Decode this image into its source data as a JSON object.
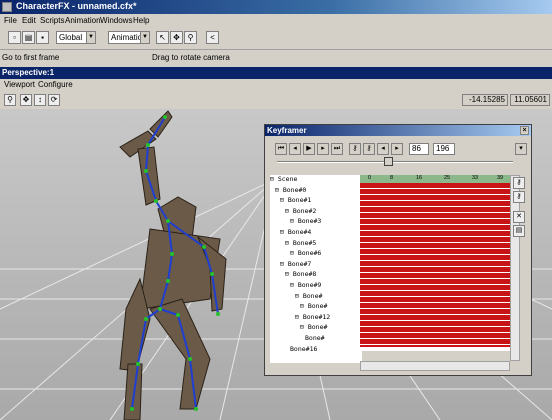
{
  "window": {
    "title": "CharacterFX - unnamed.cfx*"
  },
  "menu": [
    "File",
    "Edit",
    "Scripts",
    "Animation",
    "Windows",
    "Help"
  ],
  "toolbar": {
    "space_value": "Global",
    "mode_value": "Animation"
  },
  "status": {
    "left": "Go to first frame",
    "center": "Drag to rotate camera"
  },
  "viewport": {
    "title": "Perspective:1",
    "menu": [
      "Viewport",
      "Configure"
    ],
    "coord_x": "-14.15285",
    "coord_y": "11.05601"
  },
  "keyframer": {
    "title": "Keyframer",
    "current_frame": "86",
    "end_frame": "196",
    "slider_position": 0.47,
    "frame_ticks": [
      "0",
      "8",
      "16",
      "25",
      "33",
      "39"
    ],
    "tree": [
      "Scene",
      "Bone#0",
      "Bone#1",
      "Bone#2",
      "Bone#3",
      "Bone#4",
      "Bone#5",
      "Bone#6",
      "Bone#7",
      "Bone#8",
      "Bone#9",
      "Bone#",
      "Bone#",
      "Bone#12",
      "Bone#",
      "Bone#",
      "Bone#16"
    ]
  },
  "colors": {
    "titlebar": "#0a246a",
    "key": "#c81414",
    "keyheader": "#8ab88a",
    "bone": "#1f3fd0",
    "joint": "#22c22a"
  }
}
